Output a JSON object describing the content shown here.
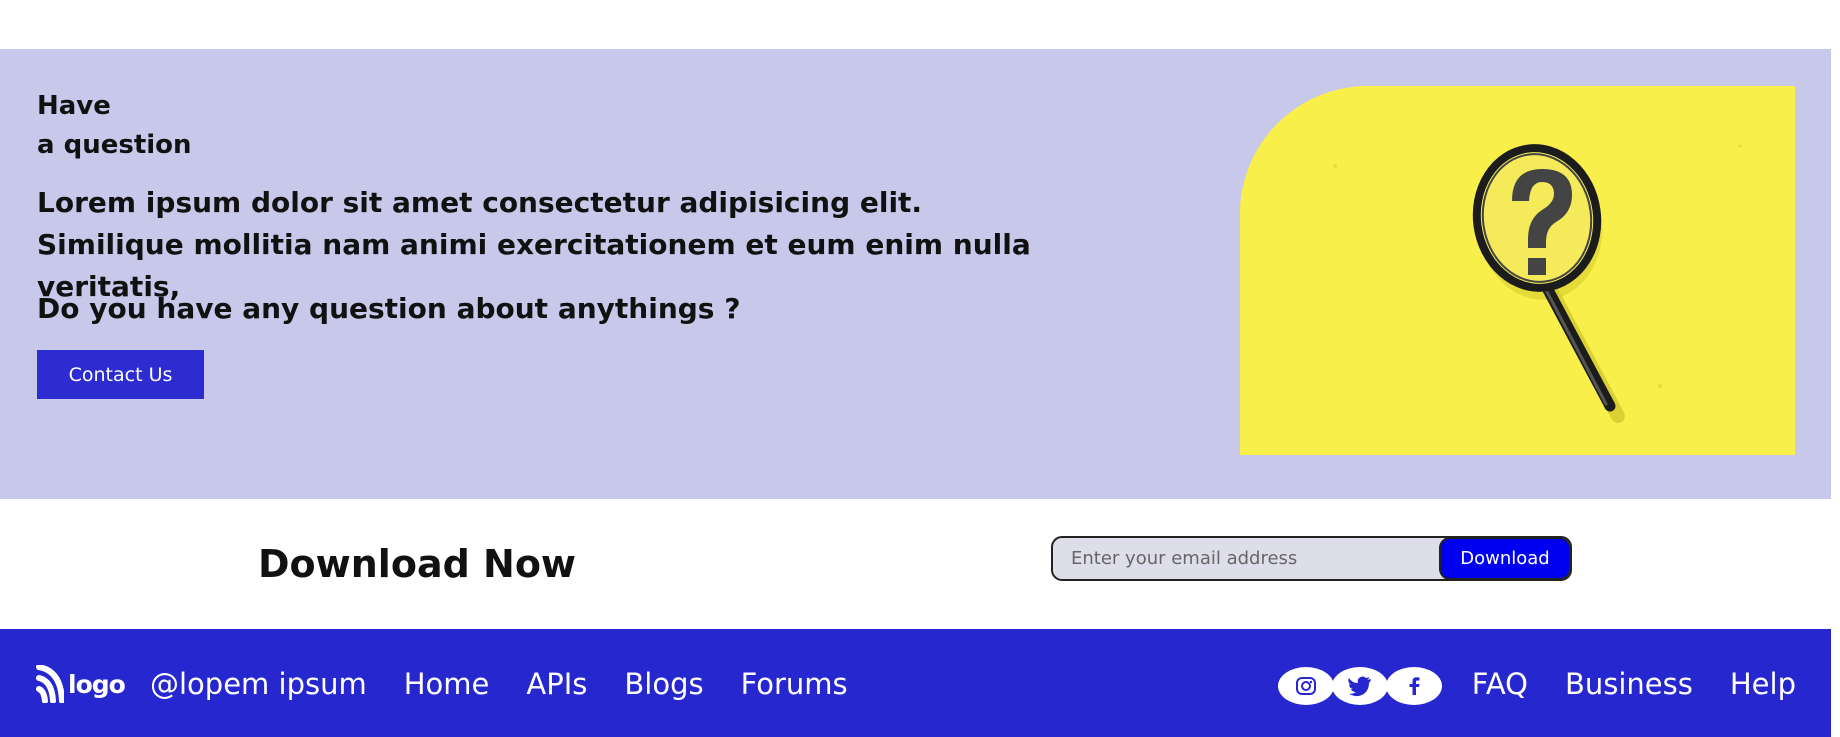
{
  "faq": {
    "heading_line1": "Have",
    "heading_line2": "a question",
    "text": "Lorem ipsum dolor sit amet consectetur adipisicing elit. Similique mollitia nam animi exercitationem et eum enim nulla veritatis,",
    "question": "Do you have any question about anythings ?",
    "contact_label": "Contact Us",
    "image_icon": "magnifying-glass-question-icon"
  },
  "download": {
    "title": "Download Now",
    "email_placeholder": "Enter your email address",
    "email_value": "",
    "button_label": "Download"
  },
  "footer": {
    "logo_text": "logo",
    "handle": "@lopem ipsum",
    "nav_left": [
      "Home",
      "APIs",
      "Blogs",
      "Forums"
    ],
    "socials": [
      "instagram-icon",
      "twitter-icon",
      "facebook-icon"
    ],
    "nav_right": [
      "FAQ",
      "Business",
      "Help"
    ]
  },
  "colors": {
    "section_bg": "#c8c8eb",
    "accent": "#2727cf",
    "download_button": "#0000f0",
    "image_bg": "#f9ef4b"
  }
}
